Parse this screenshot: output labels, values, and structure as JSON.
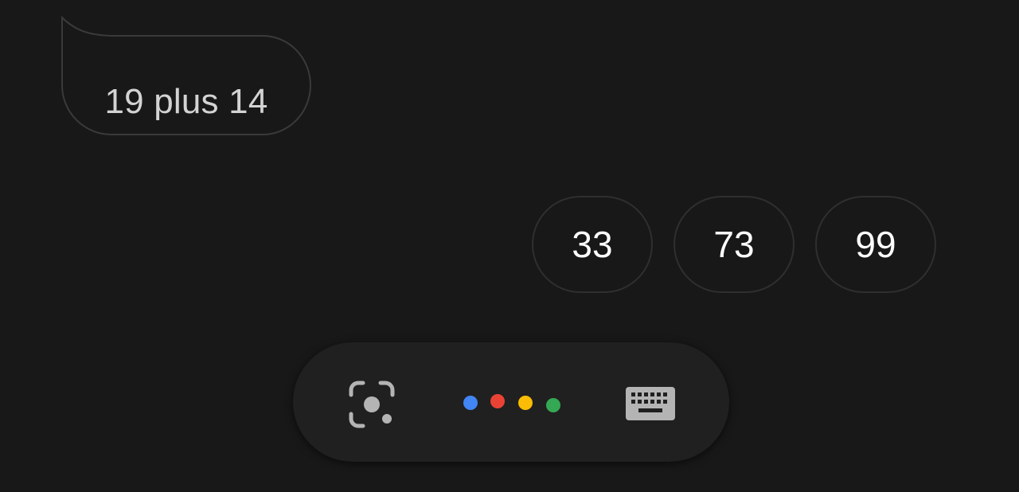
{
  "conversation": {
    "user_query": "19 plus 14"
  },
  "suggestions": [
    {
      "label": "33"
    },
    {
      "label": "73"
    },
    {
      "label": "99"
    }
  ],
  "assistant_bar": {
    "lens_icon": "lens-icon",
    "mic_icon": "assistant-dots-icon",
    "keyboard_icon": "keyboard-icon",
    "dot_colors": [
      "#4285f4",
      "#ea4335",
      "#fbbc05",
      "#34a853"
    ]
  },
  "colors": {
    "background": "#181818",
    "bubble_border": "#3a3a3a",
    "query_text": "#d3d3d3",
    "chip_text": "#ffffff",
    "icon_gray": "#b4b4b4"
  }
}
